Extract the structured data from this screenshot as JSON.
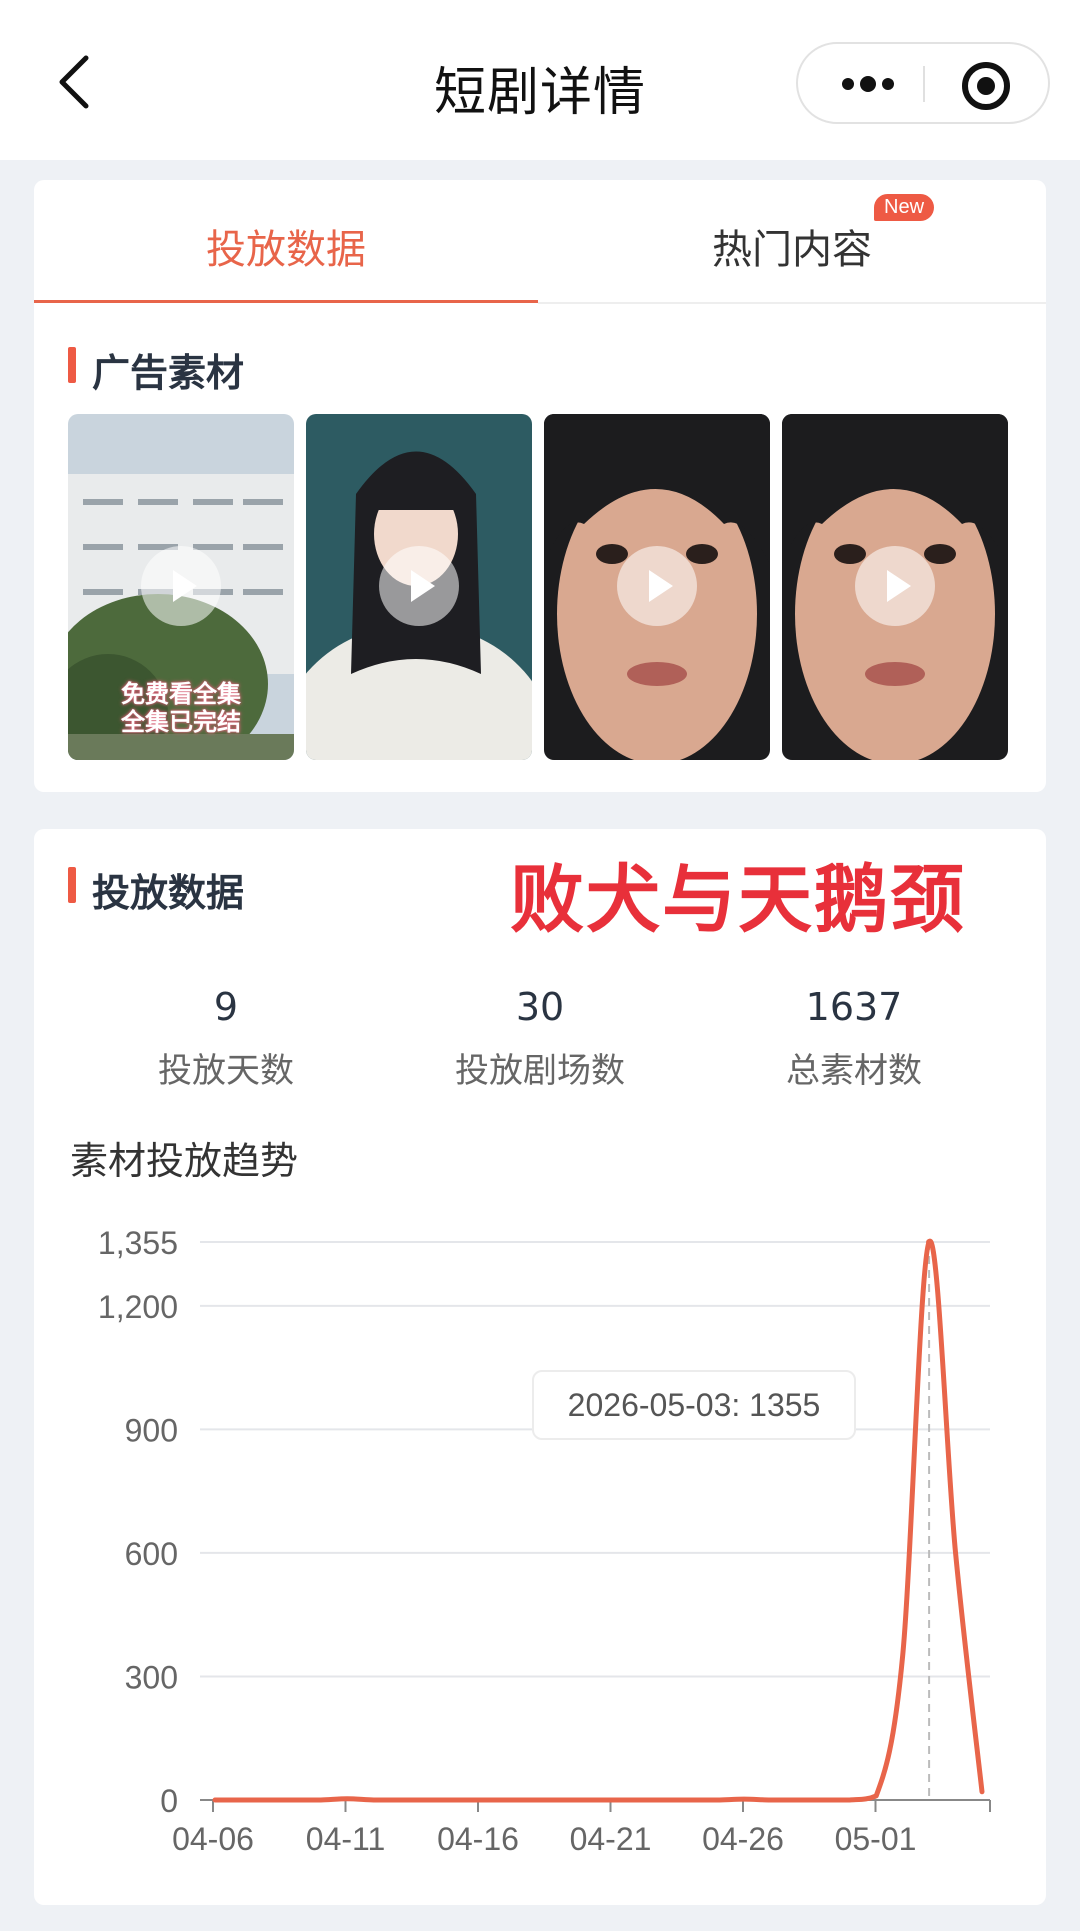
{
  "header": {
    "title": "短剧详情"
  },
  "tabs": [
    {
      "label": "投放数据",
      "active": true
    },
    {
      "label": "热门内容",
      "badge": "New"
    }
  ],
  "ad_materials": {
    "title": "广告素材",
    "thumbs": [
      {
        "caption_lines": [
          "免费看全集",
          "全集已完结"
        ]
      },
      {
        "caption_lines": []
      },
      {
        "caption_lines": []
      },
      {
        "caption_lines": []
      }
    ]
  },
  "delivery": {
    "title": "投放数据",
    "watermark": "败犬与天鹅颈",
    "stats": [
      {
        "value": "9",
        "label": "投放天数"
      },
      {
        "value": "30",
        "label": "投放剧场数"
      },
      {
        "value": "1637",
        "label": "总素材数"
      }
    ],
    "trend_title": "素材投放趋势"
  },
  "tooltip": "2026-05-03: 1355",
  "colors": {
    "accent": "#e8654a",
    "badge": "#ee5a44",
    "line": "#e8654a",
    "watermark": "#e8303a"
  },
  "chart_data": {
    "type": "line",
    "x": [
      "04-06",
      "04-07",
      "04-08",
      "04-09",
      "04-10",
      "04-11",
      "04-12",
      "04-13",
      "04-14",
      "04-15",
      "04-16",
      "04-17",
      "04-18",
      "04-19",
      "04-20",
      "04-21",
      "04-22",
      "04-23",
      "04-24",
      "04-25",
      "04-26",
      "04-27",
      "04-28",
      "04-29",
      "04-30",
      "05-01",
      "05-02",
      "05-03",
      "05-04",
      "05-05"
    ],
    "series": [
      {
        "values": [
          0,
          0,
          0,
          0,
          0,
          3,
          0,
          0,
          0,
          0,
          0,
          0,
          0,
          0,
          0,
          0,
          0,
          0,
          0,
          0,
          2,
          0,
          0,
          0,
          0,
          10,
          350,
          1355,
          600,
          20
        ]
      }
    ],
    "x_tick_labels": [
      "04-06",
      "04-11",
      "04-16",
      "04-21",
      "04-26",
      "05-01"
    ],
    "y_ticks": [
      0,
      300,
      600,
      900,
      1200,
      1355
    ],
    "y_tick_labels": [
      "0",
      "300",
      "600",
      "900",
      "1,200",
      "1,355"
    ],
    "ylim": [
      0,
      1355
    ],
    "grid": true,
    "highlight": {
      "x": "05-03",
      "value": 1355
    }
  }
}
